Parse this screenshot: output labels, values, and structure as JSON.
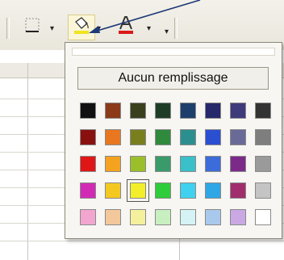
{
  "popup": {
    "no_fill_label": "Aucun remplissage",
    "selected_index": 26,
    "swatches": [
      "#111111",
      "#8b3a1a",
      "#3a3f1e",
      "#1f3d26",
      "#1d3f6b",
      "#26286b",
      "#3f3a7a",
      "#333333",
      "#8a1010",
      "#e8771f",
      "#7a7f1e",
      "#2f8a3e",
      "#2c8f8f",
      "#2b4fd1",
      "#6a6a99",
      "#7e7e7e",
      "#e01616",
      "#f4a21f",
      "#9bbf2a",
      "#3a9a6a",
      "#39c0c8",
      "#3b6cd9",
      "#7b2a8a",
      "#9a9a9a",
      "#d12bb5",
      "#f5c81f",
      "#f2ef2a",
      "#2fcc3b",
      "#3fd1ef",
      "#2fa7e6",
      "#a12d6d",
      "#c4c4c4",
      "#f2a6cf",
      "#f3c89a",
      "#f4f09e",
      "#c8efc0",
      "#d5f2f4",
      "#a9c9ec",
      "#c9a8e4",
      "#ffffff"
    ]
  },
  "toolbar": {
    "borders_icon": "borders-icon",
    "fill_icon": "fill-color-icon",
    "font_color_icon": "font-color-icon",
    "dropdown_glyph": "▾"
  },
  "colors": {
    "arrow": "#1f3a78",
    "fill_bar": "#f0e51f",
    "font_bar": "#d91a1a"
  }
}
